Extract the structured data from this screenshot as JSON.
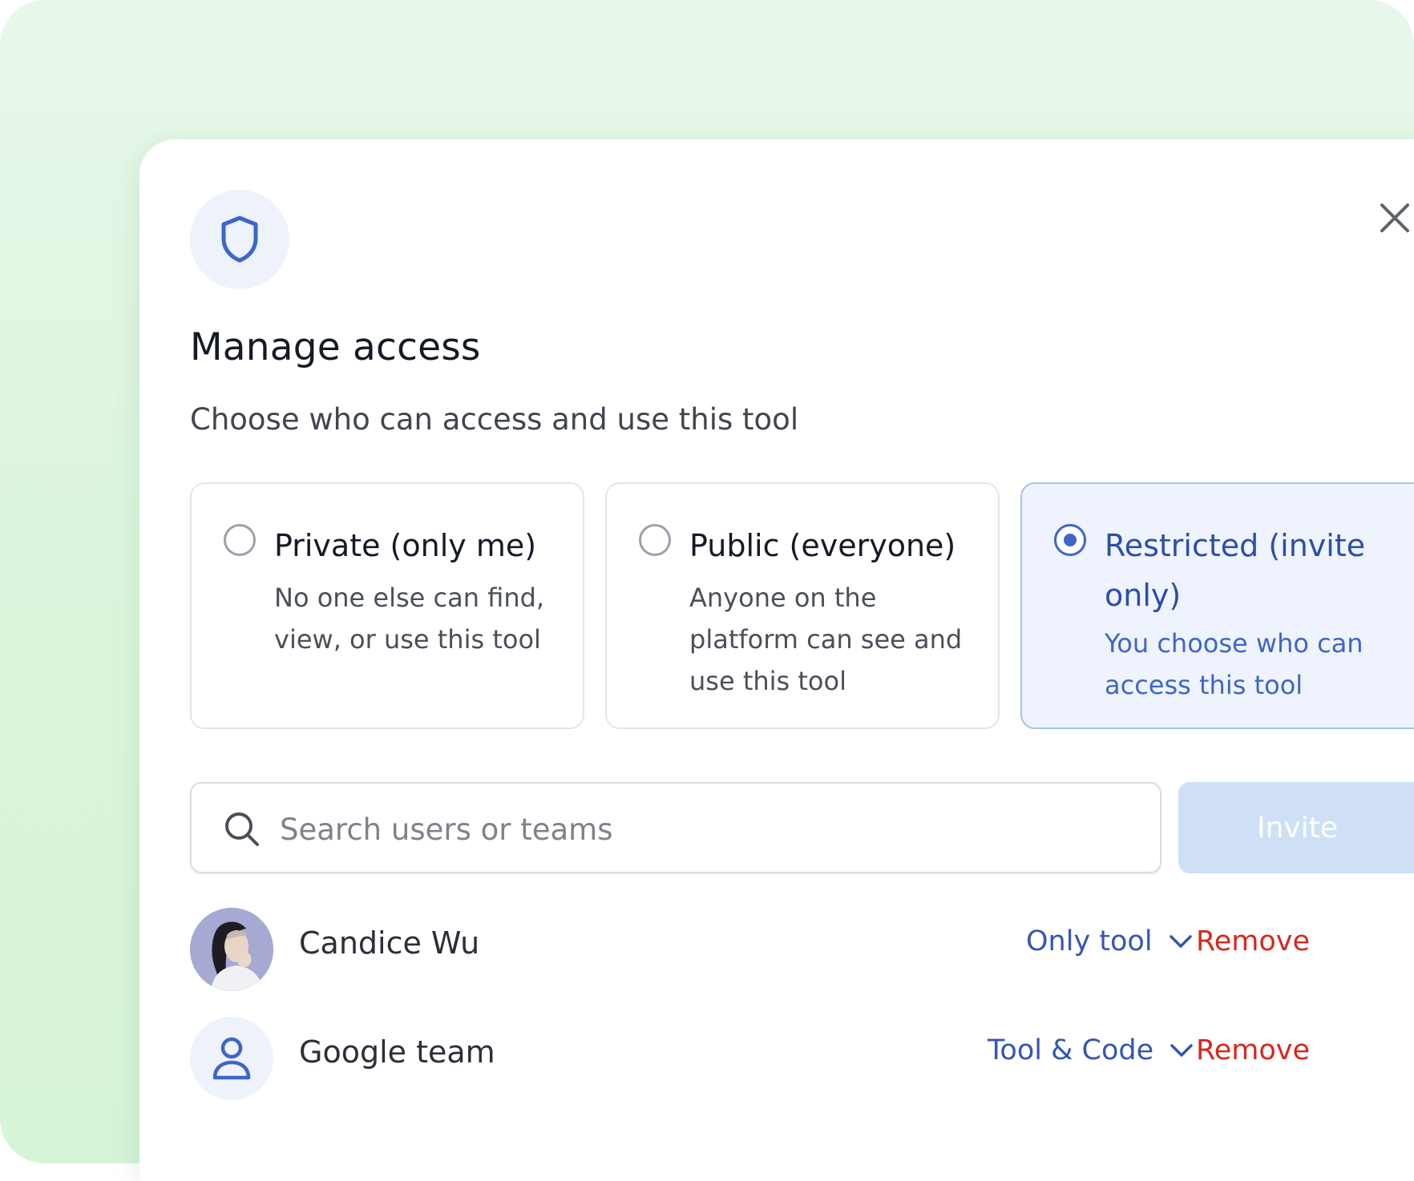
{
  "dialog": {
    "title": "Manage access",
    "subtitle": "Choose who can access and use this tool",
    "icon": "shield-icon",
    "close_icon": "close-icon"
  },
  "options": [
    {
      "title": "Private (only me)",
      "description": "No one else can find, view, or use this tool",
      "selected": false
    },
    {
      "title": "Public (everyone)",
      "description": "Anyone on the platform can see and use this tool",
      "selected": false
    },
    {
      "title": "Restricted (invite only)",
      "description": "You choose who can access this tool",
      "selected": true
    }
  ],
  "search": {
    "placeholder": "Search users or teams",
    "value": "",
    "icon": "search-icon"
  },
  "invite_button": {
    "label": "Invite"
  },
  "members": [
    {
      "name": "Candice Wu",
      "permission": "Only tool",
      "remove_label": "Remove",
      "avatar": "photo"
    },
    {
      "name": "Google team",
      "permission": "Tool & Code",
      "remove_label": "Remove",
      "avatar": "user-icon"
    }
  ],
  "colors": {
    "accent": "#3d66c8",
    "selected_background": "#eef3fd",
    "remove": "#d6281f",
    "invite_disabled": "#cfe0f6",
    "page_background": "#dcf5de"
  }
}
